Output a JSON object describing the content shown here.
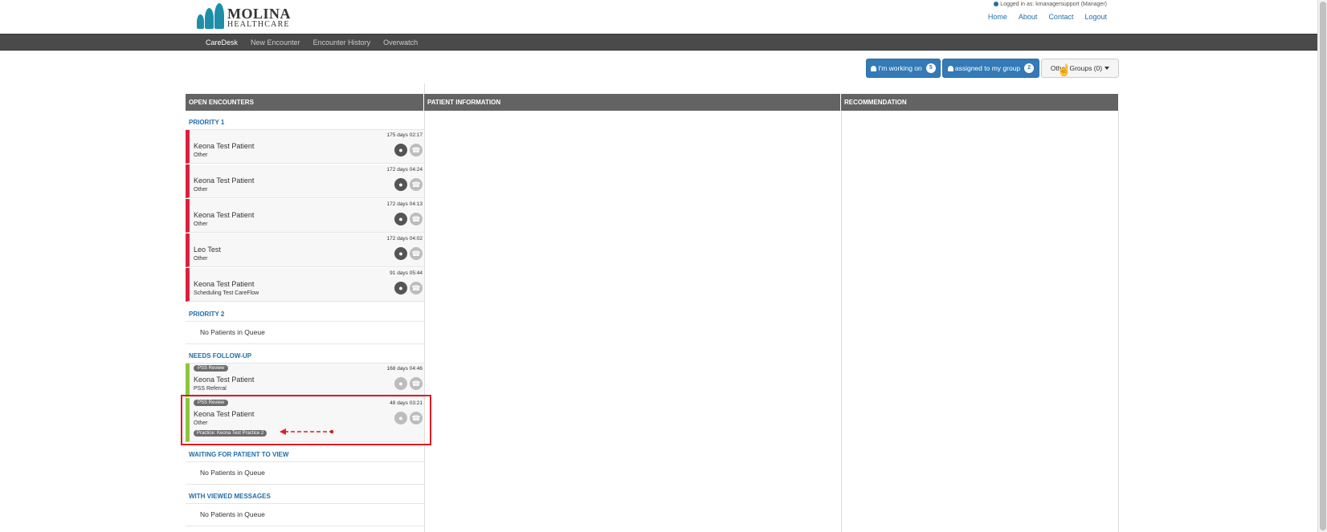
{
  "header": {
    "logo": {
      "line1": "MOLINA",
      "line2": "HEALTHCARE"
    },
    "logged_in": "Logged in as: kmanagersupport (Manager)",
    "links": [
      "Home",
      "About",
      "Contact",
      "Logout"
    ]
  },
  "nav": {
    "items": [
      "CareDesk",
      "New Encounter",
      "Encounter History",
      "Overwatch"
    ],
    "active": "CareDesk"
  },
  "actions": {
    "working_on": {
      "label": "I'm working on",
      "count": "5"
    },
    "assigned": {
      "label": "assigned to my group",
      "count": "2"
    },
    "other_groups": {
      "label": "Other Groups (0)"
    }
  },
  "panels": {
    "open_encounters": "OPEN ENCOUNTERS",
    "patient_information": "PATIENT INFORMATION",
    "recommendation": "RECOMMENDATION"
  },
  "sections": {
    "priority1": {
      "title": "PRIORITY 1",
      "items": [
        {
          "name": "Keona Test Patient",
          "sub": "Other",
          "time": "175 days 02:17"
        },
        {
          "name": "Keona Test Patient",
          "sub": "Other",
          "time": "172 days 04:24"
        },
        {
          "name": "Keona Test Patient",
          "sub": "Other",
          "time": "172 days 04:13"
        },
        {
          "name": "Leo Test",
          "sub": "Other",
          "time": "172 days 04:02"
        },
        {
          "name": "Keona Test Patient",
          "sub": "Scheduling Test CareFlow",
          "time": "91 days 05:44"
        }
      ]
    },
    "priority2": {
      "title": "PRIORITY 2",
      "empty": "No Patients in Queue"
    },
    "follow_up": {
      "title": "NEEDS FOLLOW-UP",
      "items": [
        {
          "pill": "PSS Review",
          "name": "Keona Test Patient",
          "sub": "PSS Referral",
          "time": "168 days 04:46"
        },
        {
          "pill": "PSS Review",
          "name": "Keona Test Patient",
          "sub": "Other",
          "time": "48 days 03:21",
          "practice": "Practice: Keona Test Practice 2"
        }
      ]
    },
    "waiting": {
      "title": "WAITING FOR PATIENT TO VIEW",
      "empty": "No Patients in Queue"
    },
    "viewed": {
      "title": "WITH VIEWED MESSAGES",
      "empty": "No Patients in Queue"
    }
  },
  "colors": {
    "priority": "#d9213d",
    "followup": "#8dc63f",
    "primary": "#337ab7",
    "highlight": "#e01b24"
  }
}
